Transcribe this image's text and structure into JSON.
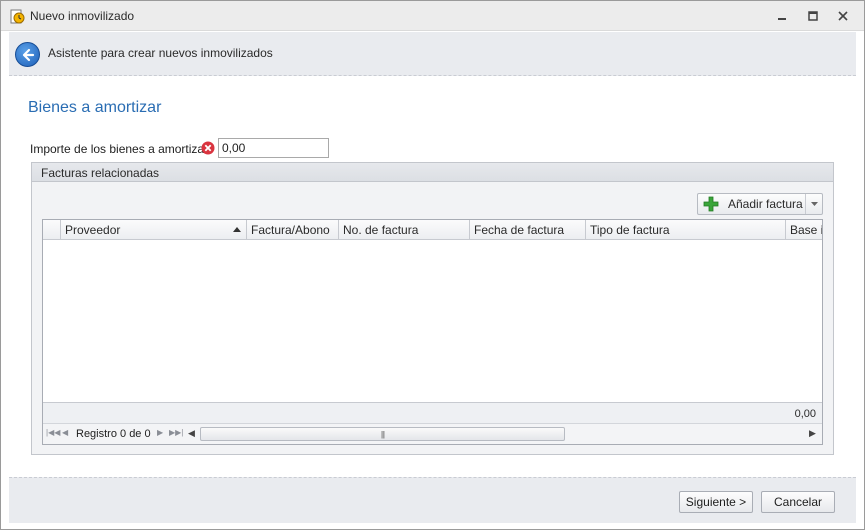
{
  "window": {
    "title": "Nuevo inmovilizado",
    "icon": "clock-document-icon"
  },
  "wizard": {
    "header_text": "Asistente para crear nuevos inmovilizados",
    "section_title": "Bienes a amortizar"
  },
  "form": {
    "amount_label": "Importe de los bienes a amortizar:",
    "amount_value": "0,00",
    "amount_error": true
  },
  "invoices_group": {
    "title": "Facturas relacionadas",
    "add_button_label": "Añadir factura",
    "columns": [
      "Proveedor",
      "Factura/Abono",
      "No. de factura",
      "Fecha de factura",
      "Tipo de factura",
      "Base i"
    ],
    "sorted_column": "Proveedor",
    "rows": [],
    "footer_total": "0,00",
    "record_text": "Registro 0 de 0"
  },
  "footer": {
    "next_label": "Siguiente >",
    "cancel_label": "Cancelar"
  },
  "colors": {
    "section_title": "#2a6db3",
    "error": "#d9343f",
    "add_plus": "#3aa53a"
  }
}
